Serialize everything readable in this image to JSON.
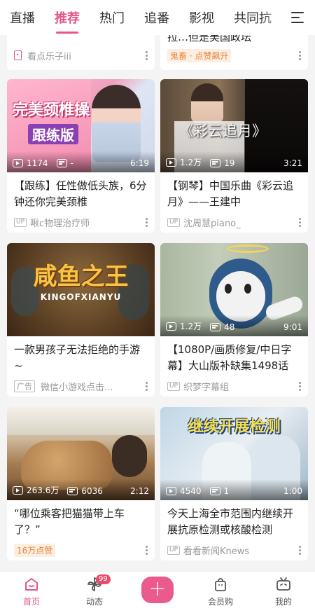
{
  "top_tabs": [
    "直播",
    "推荐",
    "热门",
    "追番",
    "影视",
    "共同抗"
  ],
  "partial_cards": {
    "left": {
      "uploader": "看点乐子iii"
    },
    "right": {
      "title_tail": "拉…但是美国政坛",
      "badge": "鬼畜 · 点赞飙升"
    }
  },
  "cards": [
    {
      "thumb_text": "完美颈椎操",
      "thumb_subtext": "跟练版",
      "views": "1174",
      "danmaku": "-",
      "duration": "6:19",
      "title": "【跟练】任性做低头族，6分钟还你完美颈椎",
      "uploader": "啾c物理治疗师",
      "up_label": "UP"
    },
    {
      "thumb_text": "《彩云追月》",
      "views": "1.2万",
      "danmaku": "19",
      "duration": "3:21",
      "title": "【钢琴】中国乐曲《彩云追月》——王建中",
      "uploader": "沈周慧piano_",
      "up_label": "UP"
    },
    {
      "thumb_text": "咸鱼之王",
      "thumb_subtext": "KINGOFXIANYU",
      "title": "一款男孩子无法拒绝的手游~",
      "ad_label": "广告",
      "uploader": "微信小游戏点击..."
    },
    {
      "views": "1.2万",
      "danmaku": "48",
      "duration": "9:01",
      "title": "【1080P/画质修复/中日字幕】大山版补缺集1498话",
      "uploader": "织梦字幕组",
      "up_label": "UP"
    },
    {
      "views": "263.6万",
      "danmaku": "6036",
      "duration": "2:12",
      "title": "“哪位乘客把猫猫带上车了？”",
      "hot_badge": "16万点赞"
    },
    {
      "thumb_text": "继续开展检测",
      "views": "4540",
      "danmaku": "1",
      "duration": "1:00",
      "title": "今天上海全市范围内继续开展抗原检测或核酸检测",
      "uploader": "看看新闻Knews",
      "up_label": "UP"
    }
  ],
  "bottom_nav": {
    "home": "首页",
    "dynamic": "动态",
    "dynamic_badge": "99",
    "plus": "+",
    "vip": "会员购",
    "mine": "我的"
  },
  "colors": {
    "accent": "#e8548b",
    "badge_orange": "#e8823a"
  }
}
